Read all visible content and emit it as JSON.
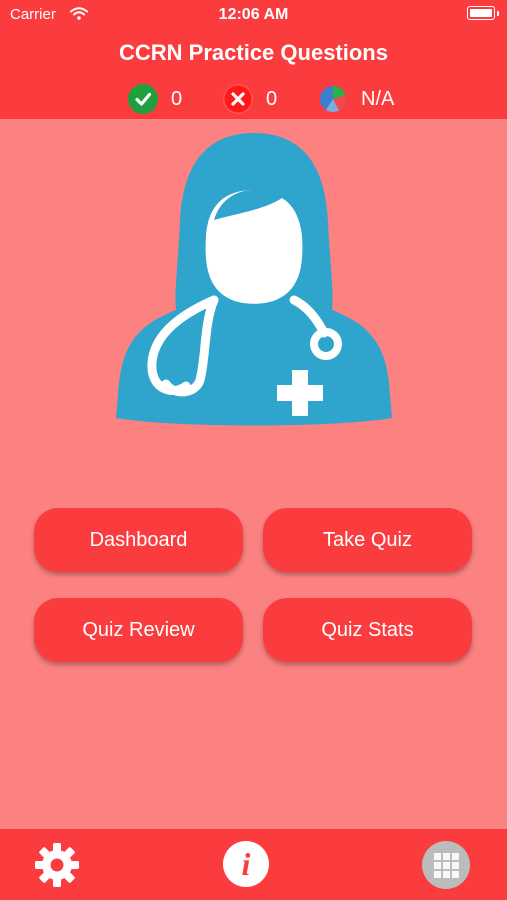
{
  "status_bar": {
    "carrier": "Carrier",
    "time": "12:06 AM"
  },
  "header": {
    "title": "CCRN Practice Questions",
    "correct_count": "0",
    "wrong_count": "0",
    "score": "N/A"
  },
  "menu": {
    "dashboard": "Dashboard",
    "take_quiz": "Take Quiz",
    "quiz_review": "Quiz Review",
    "quiz_stats": "Quiz Stats"
  },
  "footer": {
    "left_icon": "gear-icon",
    "center_icon": "info-icon",
    "right_icon": "grid-icon"
  },
  "colors": {
    "header_red": "#fb3c3f",
    "background_pink": "#fc8281",
    "doctor_blue": "#2fa4cc",
    "correct_green": "#1ea03c",
    "wrong_red": "#ff1a1a"
  }
}
